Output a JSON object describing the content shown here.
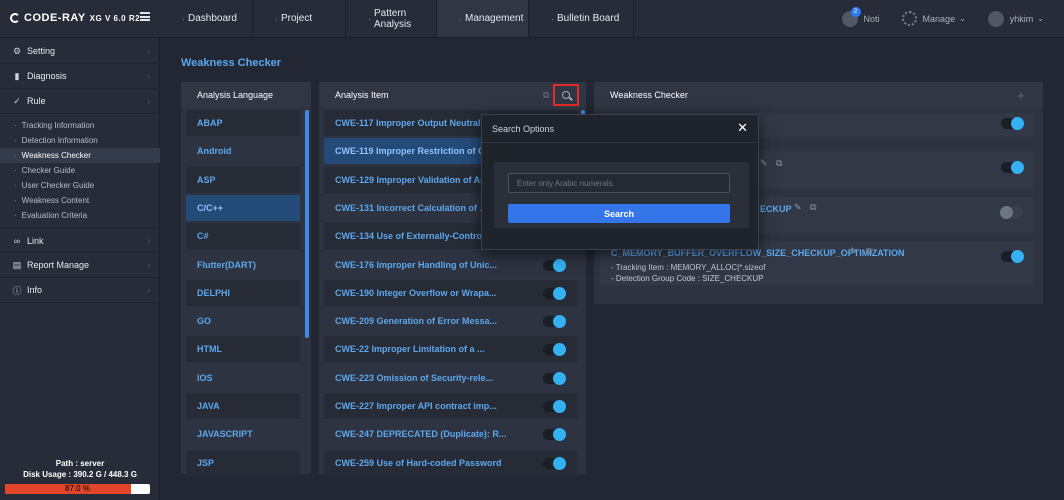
{
  "app": {
    "logo_text": "CODE-RAY",
    "logo_version": "XG V 6.0 R2"
  },
  "nav": [
    {
      "label": "Dashboard"
    },
    {
      "label": "Project"
    },
    {
      "label": "Pattern Analysis"
    },
    {
      "label": "Management"
    },
    {
      "label": "Bulletin Board"
    }
  ],
  "header_right": {
    "noti_label": "Noti",
    "noti_count": "2",
    "manage_label": "Manage",
    "user_label": "yhkim"
  },
  "sidebar": {
    "main": [
      {
        "label": "Setting"
      },
      {
        "label": "Diagnosis"
      },
      {
        "label": "Rule"
      },
      {
        "label": "Link"
      },
      {
        "label": "Report Manage"
      },
      {
        "label": "Info"
      }
    ],
    "sub": [
      {
        "label": "Tracking Information"
      },
      {
        "label": "Detection Information"
      },
      {
        "label": "Weakness Checker"
      },
      {
        "label": "Checker Guide"
      },
      {
        "label": "User Checker Guide"
      },
      {
        "label": "Weakness Content"
      },
      {
        "label": "Evaluation Criteria"
      }
    ],
    "path": "Path : server",
    "disk_usage": "Disk Usage : 390.2 G / 448.3 G",
    "disk_percent_label": "87.0 %",
    "disk_fraction": 0.87
  },
  "page": {
    "title": "Weakness Checker"
  },
  "lang_panel": {
    "header": "Analysis Language",
    "items": [
      "ABAP",
      "Android",
      "ASP",
      "C/C++",
      "C#",
      "Flutter(DART)",
      "DELPHI",
      "GO",
      "HTML",
      "IOS",
      "JAVA",
      "JAVASCRIPT",
      "JSP"
    ]
  },
  "item_panel": {
    "header": "Analysis Item",
    "items": [
      "CWE-117 Improper Output Neutraliz...",
      "CWE-119 Improper Restriction of O...",
      "CWE-129 Improper Validation of Ar...",
      "CWE-131 Incorrect Calculation of ...",
      "CWE-134 Use of Externally-Control...",
      "CWE-176 Improper Handling of Unic...",
      "CWE-190 Integer Overflow or Wrapa...",
      "CWE-209 Generation of Error Messa...",
      "CWE-22 Improper Limitation of a ...",
      "CWE-223 Omission of Security-rele...",
      "CWE-227 Improper API contract imp...",
      "CWE-247 DEPRECATED (Duplicate): R...",
      "CWE-259 Use of Hard-coded Password"
    ]
  },
  "weak_panel": {
    "header": "Weakness Checker",
    "row3_title": "ECKUP",
    "row4_title": "C_MEMORY_BUFFER_OVERFLOW_SIZE_CHECKUP_OPTIMIZATION",
    "row4_tracking": "- Tracking Item : MEMORY_ALLOC|*.sizeof",
    "row4_detection": "- Detection Group Code : SIZE_CHECKUP"
  },
  "modal": {
    "title": "Search Options",
    "placeholder": "Enter only Arabic numerals.",
    "button": "Search"
  }
}
